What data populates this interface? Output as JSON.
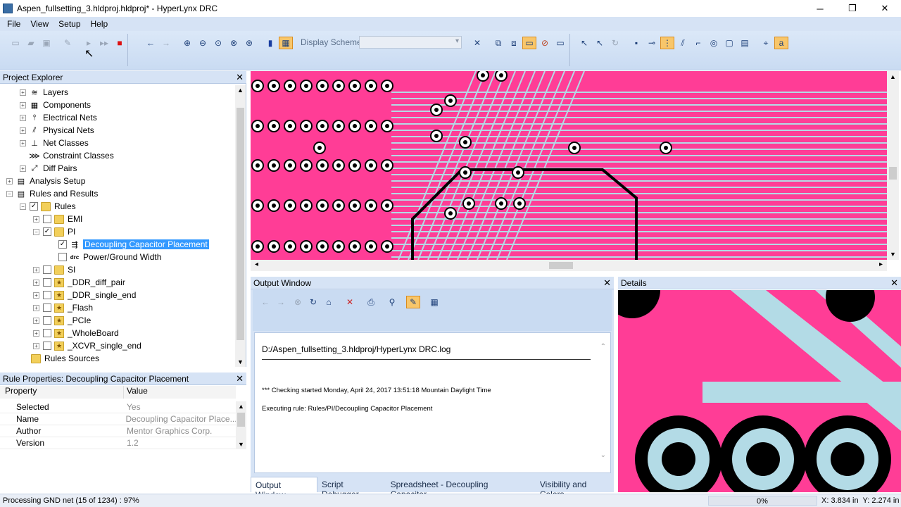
{
  "window": {
    "title": "Aspen_fullsetting_3.hldproj.hldproj* - HyperLynx DRC",
    "minimize": "─",
    "maximize": "❐",
    "close": "✕"
  },
  "menu": [
    "File",
    "View",
    "Setup",
    "Help"
  ],
  "toolbar": {
    "display_scheme_label": "Display Scheme",
    "display_scheme_value": ""
  },
  "project_explorer": {
    "title": "Project Explorer",
    "close": "✕",
    "items": [
      {
        "label": "Layers"
      },
      {
        "label": "Components"
      },
      {
        "label": "Electrical Nets"
      },
      {
        "label": "Physical Nets"
      },
      {
        "label": "Net Classes"
      },
      {
        "label": "Constraint Classes"
      },
      {
        "label": "Diff Pairs"
      },
      {
        "label": "Analysis Setup"
      },
      {
        "label": "Rules and Results"
      },
      {
        "label": "Rules"
      },
      {
        "label": "EMI"
      },
      {
        "label": "PI"
      },
      {
        "label": "Decoupling Capacitor Placement"
      },
      {
        "label": "Power/Ground Width"
      },
      {
        "label": "SI"
      },
      {
        "label": "_DDR_diff_pair"
      },
      {
        "label": "_DDR_single_end"
      },
      {
        "label": "_Flash"
      },
      {
        "label": "_PCIe"
      },
      {
        "label": "_WholeBoard"
      },
      {
        "label": "_XCVR_single_end"
      },
      {
        "label": "Rules Sources"
      }
    ]
  },
  "rule_properties": {
    "title": "Rule Properties: Decoupling Capacitor Placement",
    "close": "✕",
    "col_property": "Property",
    "col_value": "Value",
    "rows": [
      {
        "key": "Selected",
        "value": "Yes"
      },
      {
        "key": "Name",
        "value": "Decoupling Capacitor Place..."
      },
      {
        "key": "Author",
        "value": "Mentor Graphics Corp."
      },
      {
        "key": "Version",
        "value": "1.2"
      }
    ]
  },
  "output_window": {
    "title": "Output Window",
    "close": "✕",
    "log_path": "D:/Aspen_fullsetting_3.hldproj/HyperLynx DRC.log",
    "log_lines": [
      "*** Checking started Monday, April 24, 2017 13:51:18 Mountain Daylight Time",
      "Executing rule: Rules/PI/Decoupling Capacitor Placement"
    ],
    "tabs": [
      "Output Window",
      "Script Debugger",
      "Spreadsheet - Decoupling Capacitor...",
      "Visibility and Colors"
    ]
  },
  "details": {
    "title": "Details",
    "close": "✕"
  },
  "status": {
    "message": "Processing GND net (15 of 1234) : 97%",
    "progress": "0%",
    "coords": "X: 3.834 in  Y: 2.274 in"
  },
  "colors": {
    "board": "#ff3d96",
    "trace": "#b3dbe6",
    "pad_dark": "#000000"
  }
}
